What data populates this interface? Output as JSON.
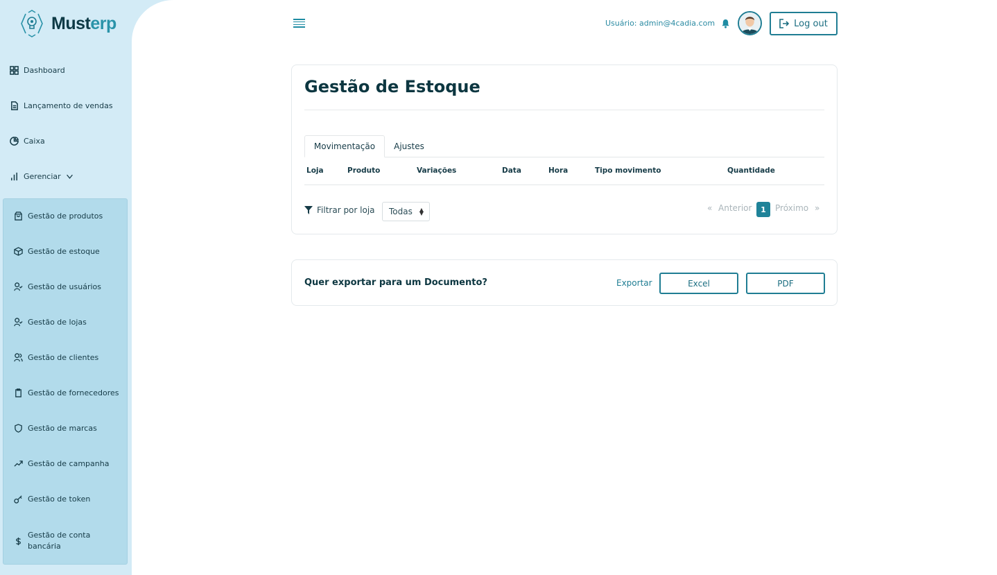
{
  "brand": {
    "name_part1": "Must",
    "name_part2": "erp"
  },
  "sidebar": {
    "items": [
      {
        "label": "Dashboard",
        "icon": "grid-icon"
      },
      {
        "label": "Lançamento de vendas",
        "icon": "document-icon"
      },
      {
        "label": "Caixa",
        "icon": "pie-chart-icon"
      },
      {
        "label": "Gerenciar",
        "icon": "bar-chart-icon"
      }
    ],
    "submenu": [
      {
        "label": "Gestão de produtos",
        "icon": "shopping-bag-icon"
      },
      {
        "label": "Gestão de estoque",
        "icon": "box-icon"
      },
      {
        "label": "Gestão de usuários",
        "icon": "user-check-icon"
      },
      {
        "label": "Gestão de lojas",
        "icon": "user-check-icon"
      },
      {
        "label": "Gestão de clientes",
        "icon": "users-icon"
      },
      {
        "label": "Gestão de fornecedores",
        "icon": "clipboard-icon"
      },
      {
        "label": "Gestão de marcas",
        "icon": "shield-icon"
      },
      {
        "label": "Gestão de campanha",
        "icon": "trending-up-icon"
      },
      {
        "label": "Gestão de token",
        "icon": "key-icon"
      },
      {
        "label": "Gestão de conta bancária",
        "icon": "dollar-icon"
      }
    ]
  },
  "header": {
    "user_label": "Usuário: admin@4cadia.com",
    "logout_label": "Log out"
  },
  "main": {
    "title": "Gestão de Estoque",
    "tabs": [
      {
        "label": "Movimentação"
      },
      {
        "label": "Ajustes"
      }
    ],
    "columns": [
      "Loja",
      "Produto",
      "Variações",
      "Data",
      "Hora",
      "Tipo movimento",
      "Quantidade"
    ],
    "filter": {
      "label": "Filtrar por loja",
      "selected": "Todas"
    },
    "pagination": {
      "first": "«",
      "prev": "Anterior",
      "page": "1",
      "next": "Próximo",
      "last": "»"
    }
  },
  "export": {
    "question": "Quer exportar para um Documento?",
    "label": "Exportar",
    "excel": "Excel",
    "pdf": "PDF"
  },
  "colors": {
    "sidebar_bg": "#d3ebf6",
    "submenu_bg": "#b2dbeb",
    "accent": "#1f7d93",
    "title": "#0c3640"
  }
}
